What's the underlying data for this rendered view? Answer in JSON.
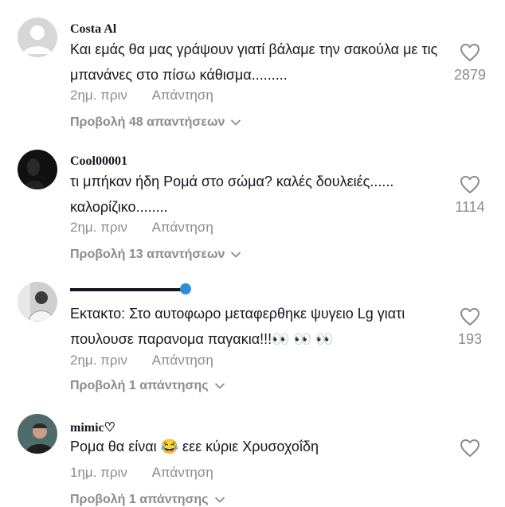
{
  "comments": [
    {
      "username": "Costa Al",
      "text": "Και εμάς θα μας γράψουν γιατί βάλαμε την σακούλα με τις μπανάνες στο πίσω κάθισμα.........",
      "time": "2ημ. πριν",
      "reply_label": "Απάντηση",
      "view_replies": "Προβολή 48 απαντήσεων",
      "likes": "2879"
    },
    {
      "username": "Cool00001",
      "text": "τι μπήκαν ήδη Ρομά στο σώμα? καλές δουλειές...... καλορίζικο........",
      "time": "2ημ. πριν",
      "reply_label": "Απάντηση",
      "view_replies": "Προβολή 13 απαντήσεων",
      "likes": "1114"
    },
    {
      "username": "",
      "text": "Εκτακτο: Στο αυτοφωρο μεταφερθηκε ψυγειο Lg γιατι πουλουσε παρανομα παγακια!!!👀 👀 👀",
      "time": "2ημ. πριν",
      "reply_label": "Απάντηση",
      "view_replies": "Προβολή 1 απάντησης",
      "likes": "193"
    },
    {
      "username": "mimic♡",
      "text": "Ρομα θα είναι 😂 εεε κύριε Χρυσοχοΐδη",
      "time": "1ημ. πριν",
      "reply_label": "Απάντηση",
      "view_replies": "Προβολή 1 απάντησης",
      "likes": ""
    }
  ],
  "icons": {
    "like": "heart-outline-icon",
    "expand": "chevron-down-icon"
  },
  "colors": {
    "text": "#161823",
    "muted": "#8a8b91",
    "icon": "#8a8b91"
  }
}
